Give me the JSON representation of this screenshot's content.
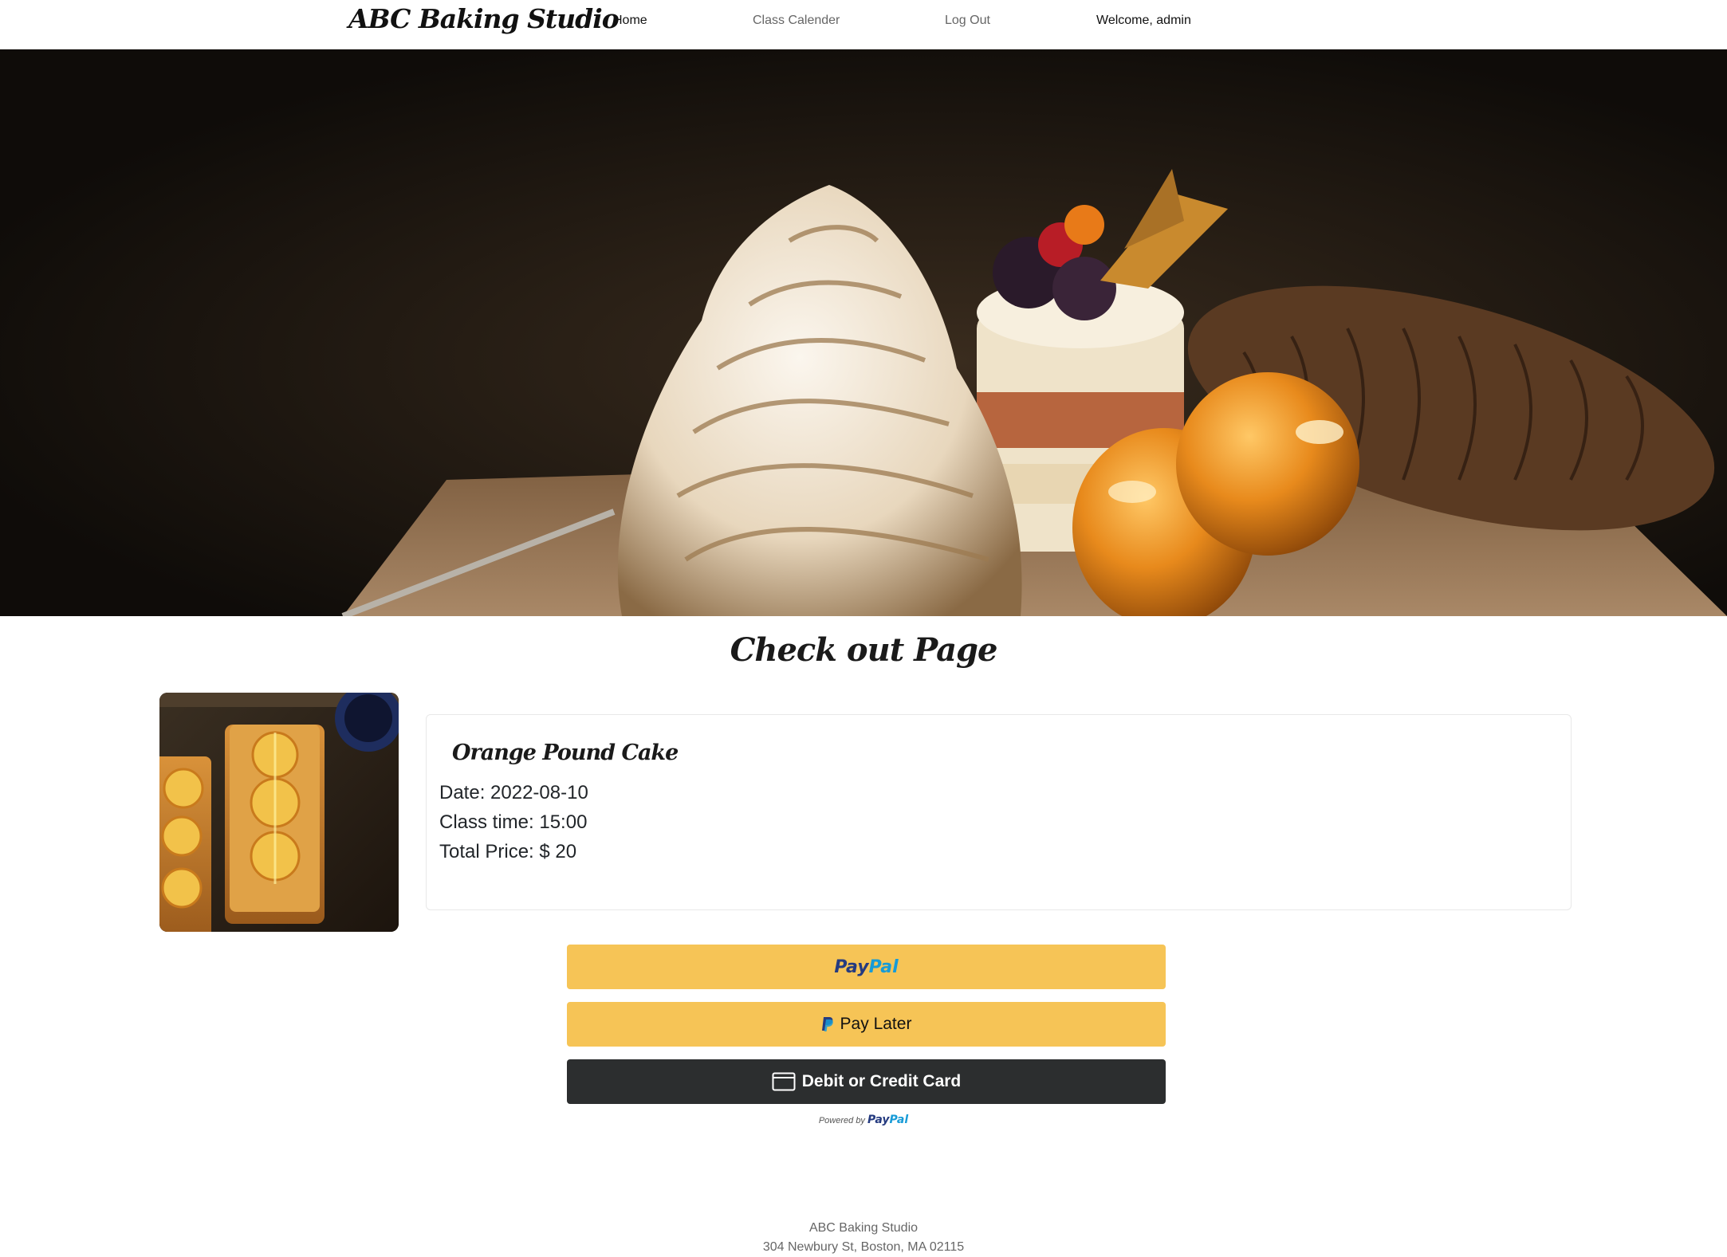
{
  "navbar": {
    "brand": "ABC Baking Studio",
    "links": [
      "Home",
      "Class Calender",
      "Log Out"
    ],
    "welcome": "Welcome, admin"
  },
  "hero": {
    "image": "dessert-photo"
  },
  "page": {
    "title": "Check out Page"
  },
  "product": {
    "image": "orange-pound-cake-photo",
    "name": "Orange Pound Cake",
    "date": "Date: 2022-08-10",
    "time": "Class time: 15:00",
    "price": "Total Price: $ 20"
  },
  "payment": {
    "paypal": {
      "pay": "Pay",
      "pal": "Pal"
    },
    "pay_later": "Pay Later",
    "card": "Debit or Credit Card",
    "powered_by": "Powered by",
    "colors": {
      "gold": "#f6c456",
      "dark": "#2c2e2f",
      "paypal_navy": "#253b80",
      "paypal_blue": "#179bd7"
    }
  },
  "footer": {
    "name": "ABC Baking Studio",
    "address": "304 Newbury St, Boston, MA 02115"
  }
}
